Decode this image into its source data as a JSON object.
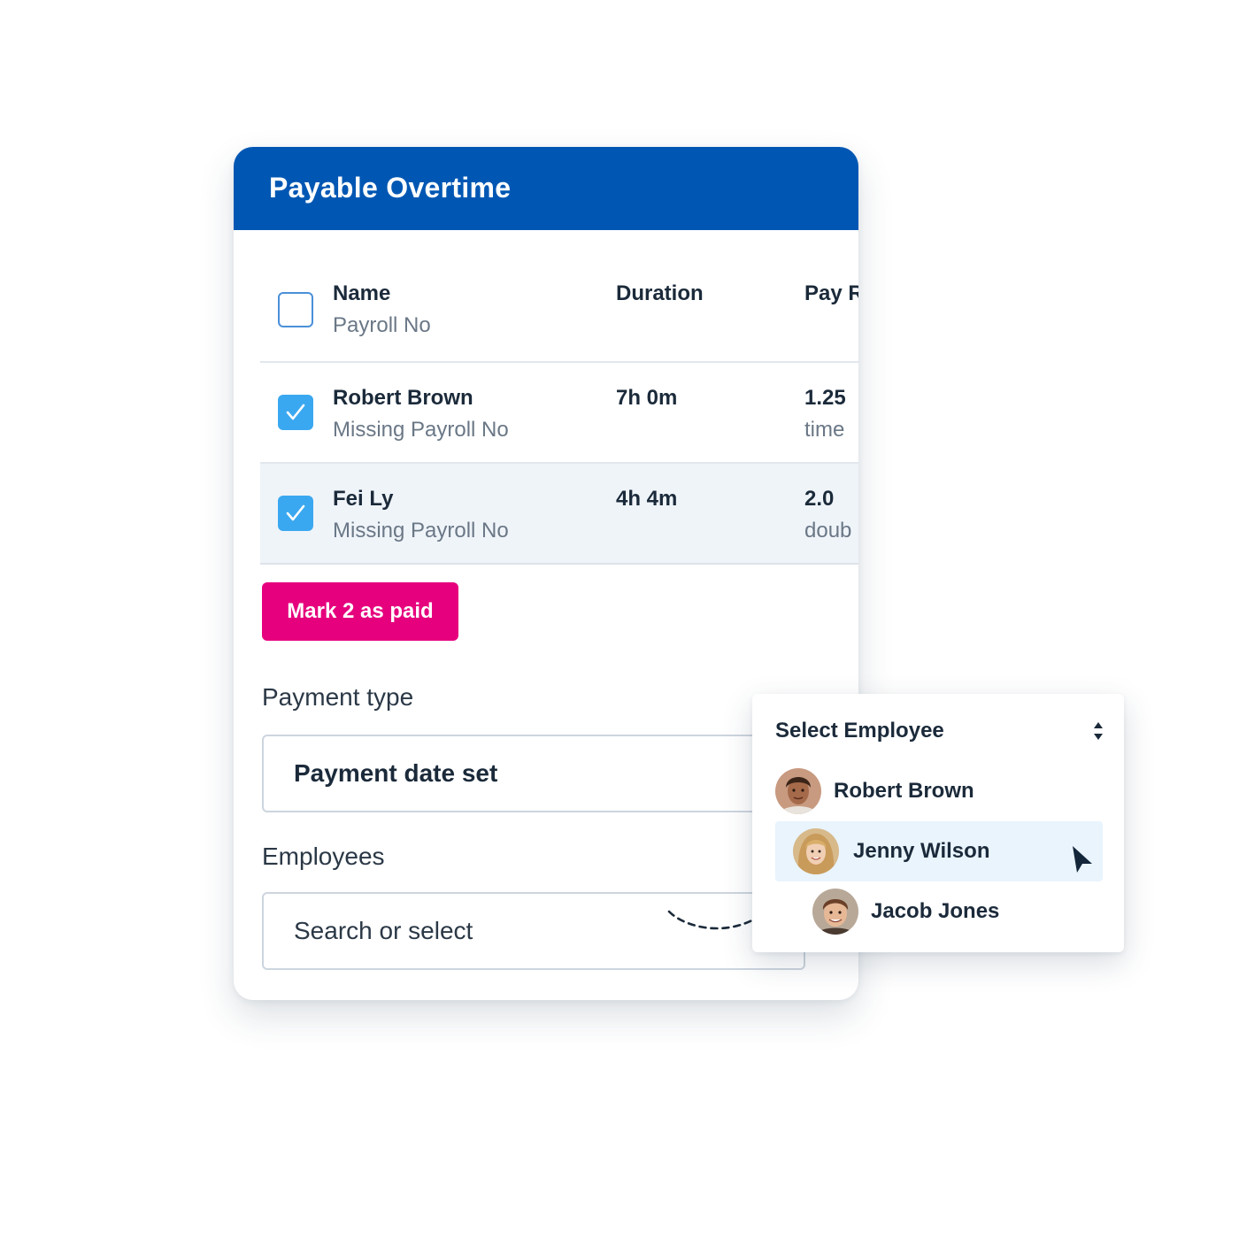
{
  "card": {
    "title": "Payable Overtime",
    "header_color": "#0057b3"
  },
  "table": {
    "columns": {
      "name": "Name",
      "name_sub": "Payroll No",
      "duration": "Duration",
      "pay_rate": "Pay R"
    },
    "rows": [
      {
        "name": "Robert Brown",
        "sub": "Missing Payroll No",
        "duration": "7h 0m",
        "pay_rate": "1.25",
        "pay_rate_sub": "time",
        "checked": true
      },
      {
        "name": "Fei Ly",
        "sub": "Missing Payroll No",
        "duration": "4h 4m",
        "pay_rate": "2.0",
        "pay_rate_sub": "doub",
        "checked": true
      }
    ]
  },
  "mark_button": {
    "label": "Mark 2 as paid",
    "color": "#e6007e"
  },
  "payment_type": {
    "label": "Payment type",
    "value": "Payment date set"
  },
  "employees": {
    "label": "Employees",
    "placeholder": "Search or select"
  },
  "dropdown": {
    "title": "Select Employee",
    "items": [
      {
        "name": "Robert Brown",
        "avatar": "avatar-man-dark-hair",
        "highlighted": false
      },
      {
        "name": "Jenny Wilson",
        "avatar": "avatar-woman-blonde",
        "highlighted": true
      },
      {
        "name": "Jacob Jones",
        "avatar": "avatar-man-brown-hair",
        "highlighted": false
      }
    ]
  },
  "colors": {
    "checkbox_checked": "#3aa8f0",
    "highlight_row": "#eff4f9",
    "dropdown_highlight": "#e9f4fd"
  }
}
